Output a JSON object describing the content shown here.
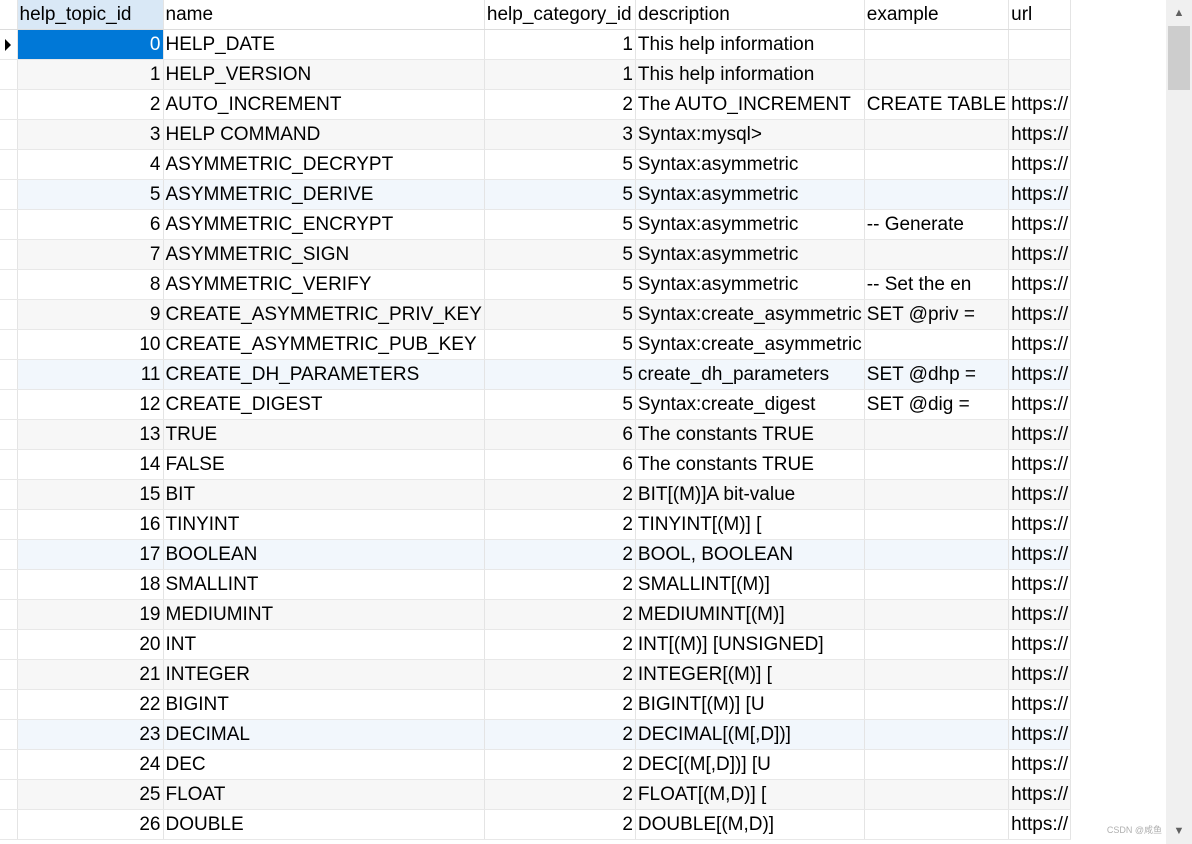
{
  "grid": {
    "columns": [
      "help_topic_id",
      "name",
      "help_category_id",
      "description",
      "example",
      "url"
    ],
    "selected_column": "help_topic_id",
    "rows": [
      [
        "0",
        "HELP_DATE",
        "1",
        "This help information",
        "",
        ""
      ],
      [
        "1",
        "HELP_VERSION",
        "1",
        "This help information",
        "",
        ""
      ],
      [
        "2",
        "AUTO_INCREMENT",
        "2",
        "The AUTO_INCREMENT",
        "CREATE TABLE",
        "https://"
      ],
      [
        "3",
        "HELP COMMAND",
        "3",
        "Syntax:mysql>",
        "",
        "https://"
      ],
      [
        "4",
        "ASYMMETRIC_DECRYPT",
        "5",
        "Syntax:asymmetric",
        "",
        "https://"
      ],
      [
        "5",
        "ASYMMETRIC_DERIVE",
        "5",
        "Syntax:asymmetric",
        "",
        "https://"
      ],
      [
        "6",
        "ASYMMETRIC_ENCRYPT",
        "5",
        "Syntax:asymmetric",
        "-- Generate",
        "https://"
      ],
      [
        "7",
        "ASYMMETRIC_SIGN",
        "5",
        "Syntax:asymmetric",
        "",
        "https://"
      ],
      [
        "8",
        "ASYMMETRIC_VERIFY",
        "5",
        "Syntax:asymmetric",
        "-- Set the en",
        "https://"
      ],
      [
        "9",
        "CREATE_ASYMMETRIC_PRIV_KEY",
        "5",
        "Syntax:create_asymmetric",
        "SET @priv =",
        "https://"
      ],
      [
        "10",
        "CREATE_ASYMMETRIC_PUB_KEY",
        "5",
        "Syntax:create_asymmetric",
        "",
        "https://"
      ],
      [
        "11",
        "CREATE_DH_PARAMETERS",
        "5",
        "create_dh_parameters",
        "SET @dhp =",
        "https://"
      ],
      [
        "12",
        "CREATE_DIGEST",
        "5",
        "Syntax:create_digest",
        "SET @dig =",
        "https://"
      ],
      [
        "13",
        "TRUE",
        "6",
        "The constants TRUE",
        "",
        "https://"
      ],
      [
        "14",
        "FALSE",
        "6",
        "The constants TRUE",
        "",
        "https://"
      ],
      [
        "15",
        "BIT",
        "2",
        "BIT[(M)]A bit-value",
        "",
        "https://"
      ],
      [
        "16",
        "TINYINT",
        "2",
        "TINYINT[(M)] [",
        "",
        "https://"
      ],
      [
        "17",
        "BOOLEAN",
        "2",
        "BOOL, BOOLEAN",
        "",
        "https://"
      ],
      [
        "18",
        "SMALLINT",
        "2",
        "SMALLINT[(M)]",
        "",
        "https://"
      ],
      [
        "19",
        "MEDIUMINT",
        "2",
        "MEDIUMINT[(M)]",
        "",
        "https://"
      ],
      [
        "20",
        "INT",
        "2",
        "INT[(M)] [UNSIGNED]",
        "",
        "https://"
      ],
      [
        "21",
        "INTEGER",
        "2",
        "INTEGER[(M)] [",
        "",
        "https://"
      ],
      [
        "22",
        "BIGINT",
        "2",
        "BIGINT[(M)] [U",
        "",
        "https://"
      ],
      [
        "23",
        "DECIMAL",
        "2",
        "DECIMAL[(M[,D])]",
        "",
        "https://"
      ],
      [
        "24",
        "DEC",
        "2",
        "DEC[(M[,D])] [U",
        "",
        "https://"
      ],
      [
        "25",
        "FLOAT",
        "2",
        "FLOAT[(M,D)] [",
        "",
        "https://"
      ],
      [
        "26",
        "DOUBLE",
        "2",
        "DOUBLE[(M,D)]",
        "",
        "https://"
      ]
    ]
  },
  "selection": {
    "row": 0,
    "column": 0
  },
  "row_indicator_icon": "current-row-arrow-icon",
  "watermark": "CSDN @咸鱼",
  "colors": {
    "selection": "#0078d7",
    "header_selected": "#d9e8f6",
    "row_alt": "#f7f7f7"
  }
}
